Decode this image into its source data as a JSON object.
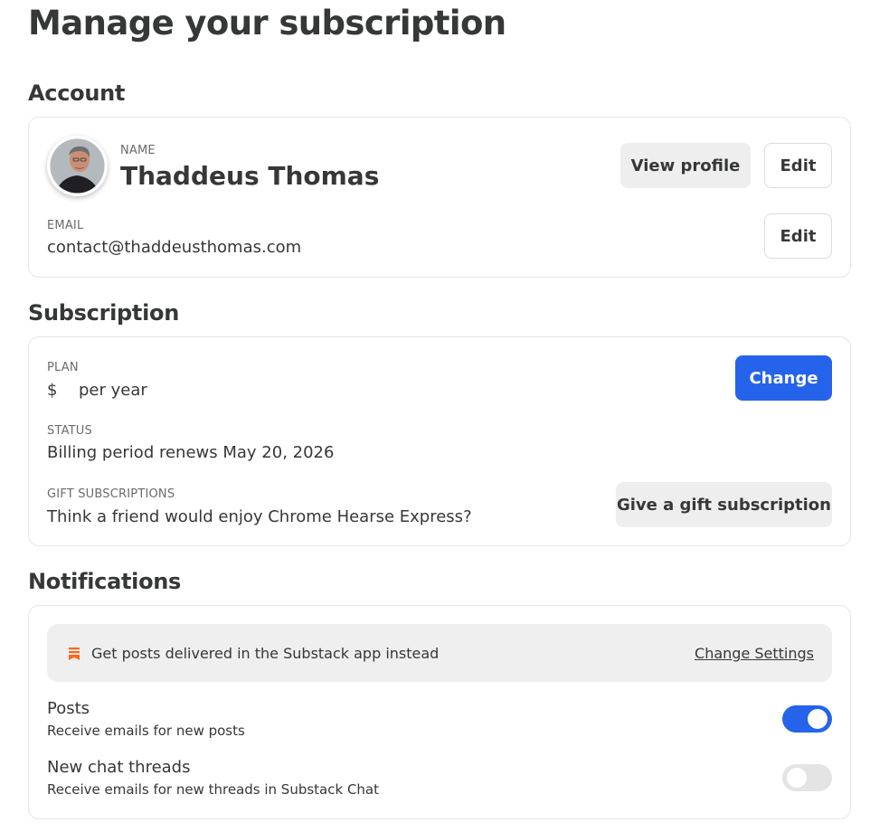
{
  "page": {
    "title": "Manage your subscription"
  },
  "account": {
    "heading": "Account",
    "name_label": "NAME",
    "name": "Thaddeus Thomas",
    "view_profile_label": "View profile",
    "edit_name_label": "Edit",
    "email_label": "EMAIL",
    "email": "contact@thaddeusthomas.com",
    "edit_email_label": "Edit"
  },
  "subscription": {
    "heading": "Subscription",
    "plan_label": "PLAN",
    "plan_currency": "$",
    "plan_period": "per year",
    "change_label": "Change",
    "status_label": "STATUS",
    "status_value": "Billing period renews May 20, 2026",
    "gift_label": "GIFT SUBSCRIPTIONS",
    "gift_text": "Think a friend would enjoy Chrome Hearse Express?",
    "gift_button_label": "Give a gift subscription"
  },
  "notifications": {
    "heading": "Notifications",
    "banner_icon": "substack-bookmark-icon",
    "banner_text": "Get posts delivered in the Substack app instead",
    "banner_link": "Change Settings",
    "items": [
      {
        "title": "Posts",
        "description": "Receive emails for new posts",
        "enabled": true
      },
      {
        "title": "New chat threads",
        "description": "Receive emails for new threads in Substack Chat",
        "enabled": false
      }
    ]
  },
  "colors": {
    "accent": "#2563eb",
    "substack_orange": "#ff6719",
    "text": "#363737"
  }
}
